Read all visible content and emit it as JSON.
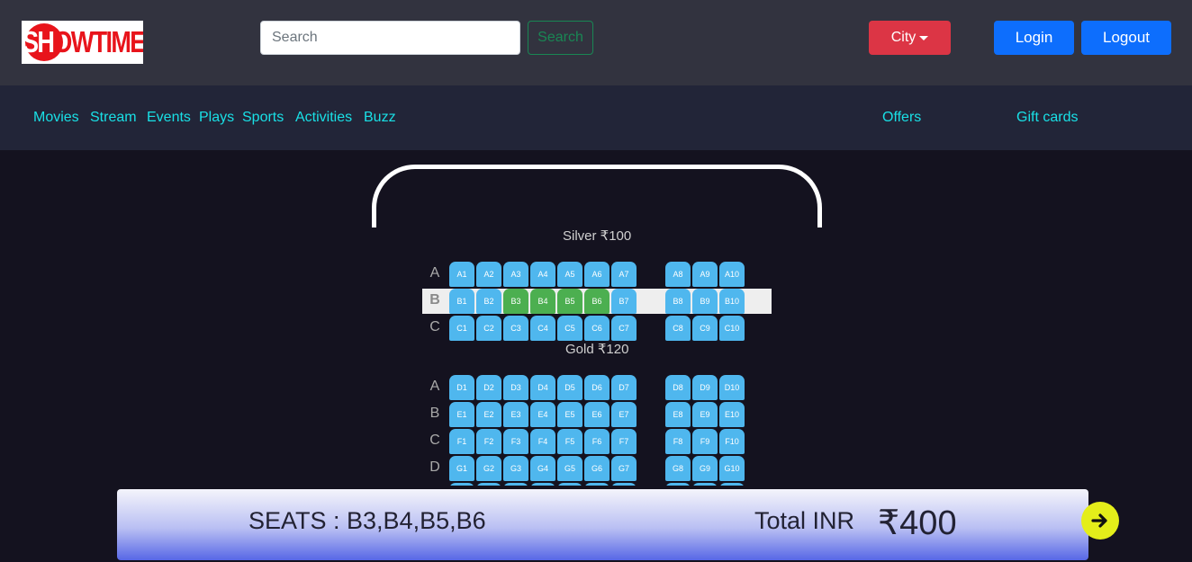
{
  "header": {
    "logo_text": "SHOWTIME",
    "search": {
      "placeholder": "Search",
      "value": "",
      "button_label": "Search"
    },
    "city_label": "City",
    "login_label": "Login",
    "logout_label": "Logout"
  },
  "nav": {
    "items": [
      "Movies",
      "Stream",
      "Events",
      "Plays",
      "Sports",
      "Activities",
      "Buzz"
    ],
    "right_items": [
      "Offers",
      "Gift cards"
    ]
  },
  "seat_layout": {
    "sections": [
      {
        "label": "Silver ₹100",
        "rows": [
          {
            "letter": "A",
            "seats": [
              "A1",
              "A2",
              "A3",
              "A4",
              "A5",
              "A6",
              "A7",
              "A8",
              "A9",
              "A10"
            ]
          },
          {
            "letter": "B",
            "seats": [
              "B1",
              "B2",
              "B3",
              "B4",
              "B5",
              "B6",
              "B7",
              "B8",
              "B9",
              "B10"
            ],
            "highlighted": true
          },
          {
            "letter": "C",
            "seats": [
              "C1",
              "C2",
              "C3",
              "C4",
              "C5",
              "C6",
              "C7",
              "C8",
              "C9",
              "C10"
            ]
          }
        ]
      },
      {
        "label": "Gold ₹120",
        "rows": [
          {
            "letter": "A",
            "seats": [
              "D1",
              "D2",
              "D3",
              "D4",
              "D5",
              "D6",
              "D7",
              "D8",
              "D9",
              "D10"
            ]
          },
          {
            "letter": "B",
            "seats": [
              "E1",
              "E2",
              "E3",
              "E4",
              "E5",
              "E6",
              "E7",
              "E8",
              "E9",
              "E10"
            ]
          },
          {
            "letter": "C",
            "seats": [
              "F1",
              "F2",
              "F3",
              "F4",
              "F5",
              "F6",
              "F7",
              "F8",
              "F9",
              "F10"
            ]
          },
          {
            "letter": "D",
            "seats": [
              "G1",
              "G2",
              "G3",
              "G4",
              "G5",
              "G6",
              "G7",
              "G8",
              "G9",
              "G10"
            ]
          },
          {
            "letter": "",
            "seats": [
              "",
              "",
              "",
              "",
              "",
              "",
              "",
              "",
              "",
              ""
            ]
          }
        ]
      }
    ],
    "selected": [
      "B3",
      "B4",
      "B5",
      "B6"
    ]
  },
  "summary": {
    "seats_text": "SEATS : B3,B4,B5,B6",
    "total_label": "Total INR",
    "total_value": "₹400",
    "proceed_icon": "arrow-right-icon"
  },
  "colors": {
    "seat_available": "#4fb7ee",
    "seat_selected": "#4caf50",
    "nav_link": "#19e0e6",
    "city_button": "#dc3545",
    "auth_button": "#0d6efd",
    "proceed_button": "#e4ee1a"
  }
}
